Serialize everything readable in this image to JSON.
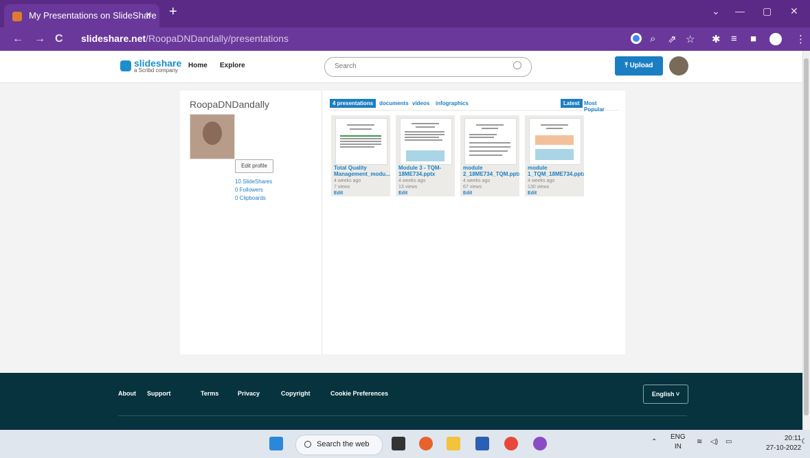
{
  "browser": {
    "tab_title": "My Presentations on SlideShare",
    "tab_close": "×",
    "new_tab": "+",
    "url_host": "slideshare.net",
    "url_path": "/RoopaDNDandally/presentations",
    "back": "←",
    "forward": "→",
    "reload": "C",
    "min": "—",
    "restore": "▢",
    "close": "✕",
    "collapse": "⌄"
  },
  "header": {
    "logo_word": "slideshare",
    "logo_sub": "a Scribd company",
    "nav": [
      "Home",
      "Explore"
    ],
    "search_placeholder": "Search",
    "upload_label": "Upload",
    "upload_icon": "upload-icon"
  },
  "profile": {
    "username": "RoopaDNDandally",
    "edit_profile": "Edit profile",
    "stats": [
      "10 SlideShares",
      "0 Followers",
      "0 Clipboards"
    ]
  },
  "content": {
    "tabs": [
      "4 presentations",
      "documents",
      "videos",
      "infographics"
    ],
    "sort": [
      "Latest",
      "Most Popular"
    ],
    "decks": [
      {
        "title": "Total Quality\nManagement_modu...",
        "age": "4 weeks ago",
        "views": "7 views",
        "edit": "Edit"
      },
      {
        "title": "Module 3 - TQM-\n18ME734.pptx",
        "age": "4 weeks ago",
        "views": "13 views",
        "edit": "Edit"
      },
      {
        "title": "module\n2_18ME734_TQM.pptx",
        "age": "4 weeks ago",
        "views": "67 views",
        "edit": "Edit"
      },
      {
        "title": "module\n1_TQM_18ME734.pptx",
        "age": "4 weeks ago",
        "views": "130 views",
        "edit": "Edit"
      }
    ]
  },
  "footer": {
    "links": [
      "About",
      "Support",
      "Terms",
      "Privacy",
      "Copyright",
      "Cookie Preferences"
    ],
    "language": "English ˅"
  },
  "taskbar": {
    "search_label": "Search the web",
    "lang_top": "ENG",
    "lang_bottom": "IN",
    "time": "20:11",
    "date": "27-10-2022"
  }
}
